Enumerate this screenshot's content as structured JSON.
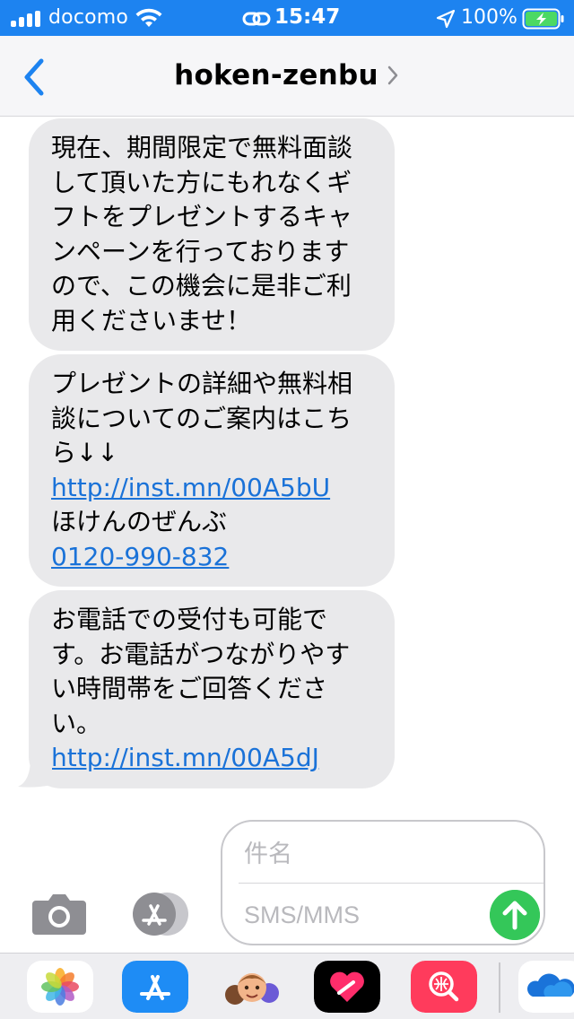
{
  "status_bar": {
    "carrier": "docomo",
    "time": "15:47",
    "battery_percent": "100%",
    "signal_bars": 4,
    "wifi": true,
    "location_active": true,
    "charging": true
  },
  "nav": {
    "contact_name": "hoken-zenbu",
    "back_icon": "chevron-left-icon",
    "detail_icon": "chevron-right-icon"
  },
  "messages": [
    {
      "lines": [
        "現在、期間限定で無料面談",
        "して頂いた方にもれなくギ",
        "フトをプレゼントするキャ",
        "ンペーンを行っております",
        "ので、この機会に是非ご利",
        "用くださいませ！"
      ]
    },
    {
      "lines": [
        "プレゼントの詳細や無料相",
        "談についてのご案内はこち",
        "ら↓↓"
      ],
      "link": "http://inst.mn/00A5bU",
      "sender_name": "ほけんのぜんぶ",
      "phone": "0120-990-832"
    },
    {
      "lines": [
        "お電話での受付も可能で",
        "す。お電話がつながりやす",
        "い時間帯をご回答くださ",
        "い。"
      ],
      "link": "http://inst.mn/00A5dJ"
    }
  ],
  "compose": {
    "subject_placeholder": "件名",
    "body_placeholder": "SMS/MMS",
    "camera_icon": "camera-icon",
    "appstore_icon": "app-store-icon",
    "send_icon": "arrow-up-icon"
  },
  "app_drawer": {
    "apps": [
      "photos-icon",
      "app-store-icon",
      "memoji-icon",
      "digital-touch-icon",
      "images-search-icon",
      "onedrive-icon"
    ]
  },
  "colors": {
    "status_bar_bg": "#1d83f0",
    "bubble_bg": "#e9e9eb",
    "link": "#1a72d8",
    "send_button": "#34c759",
    "nav_accent": "#1d83f0"
  }
}
